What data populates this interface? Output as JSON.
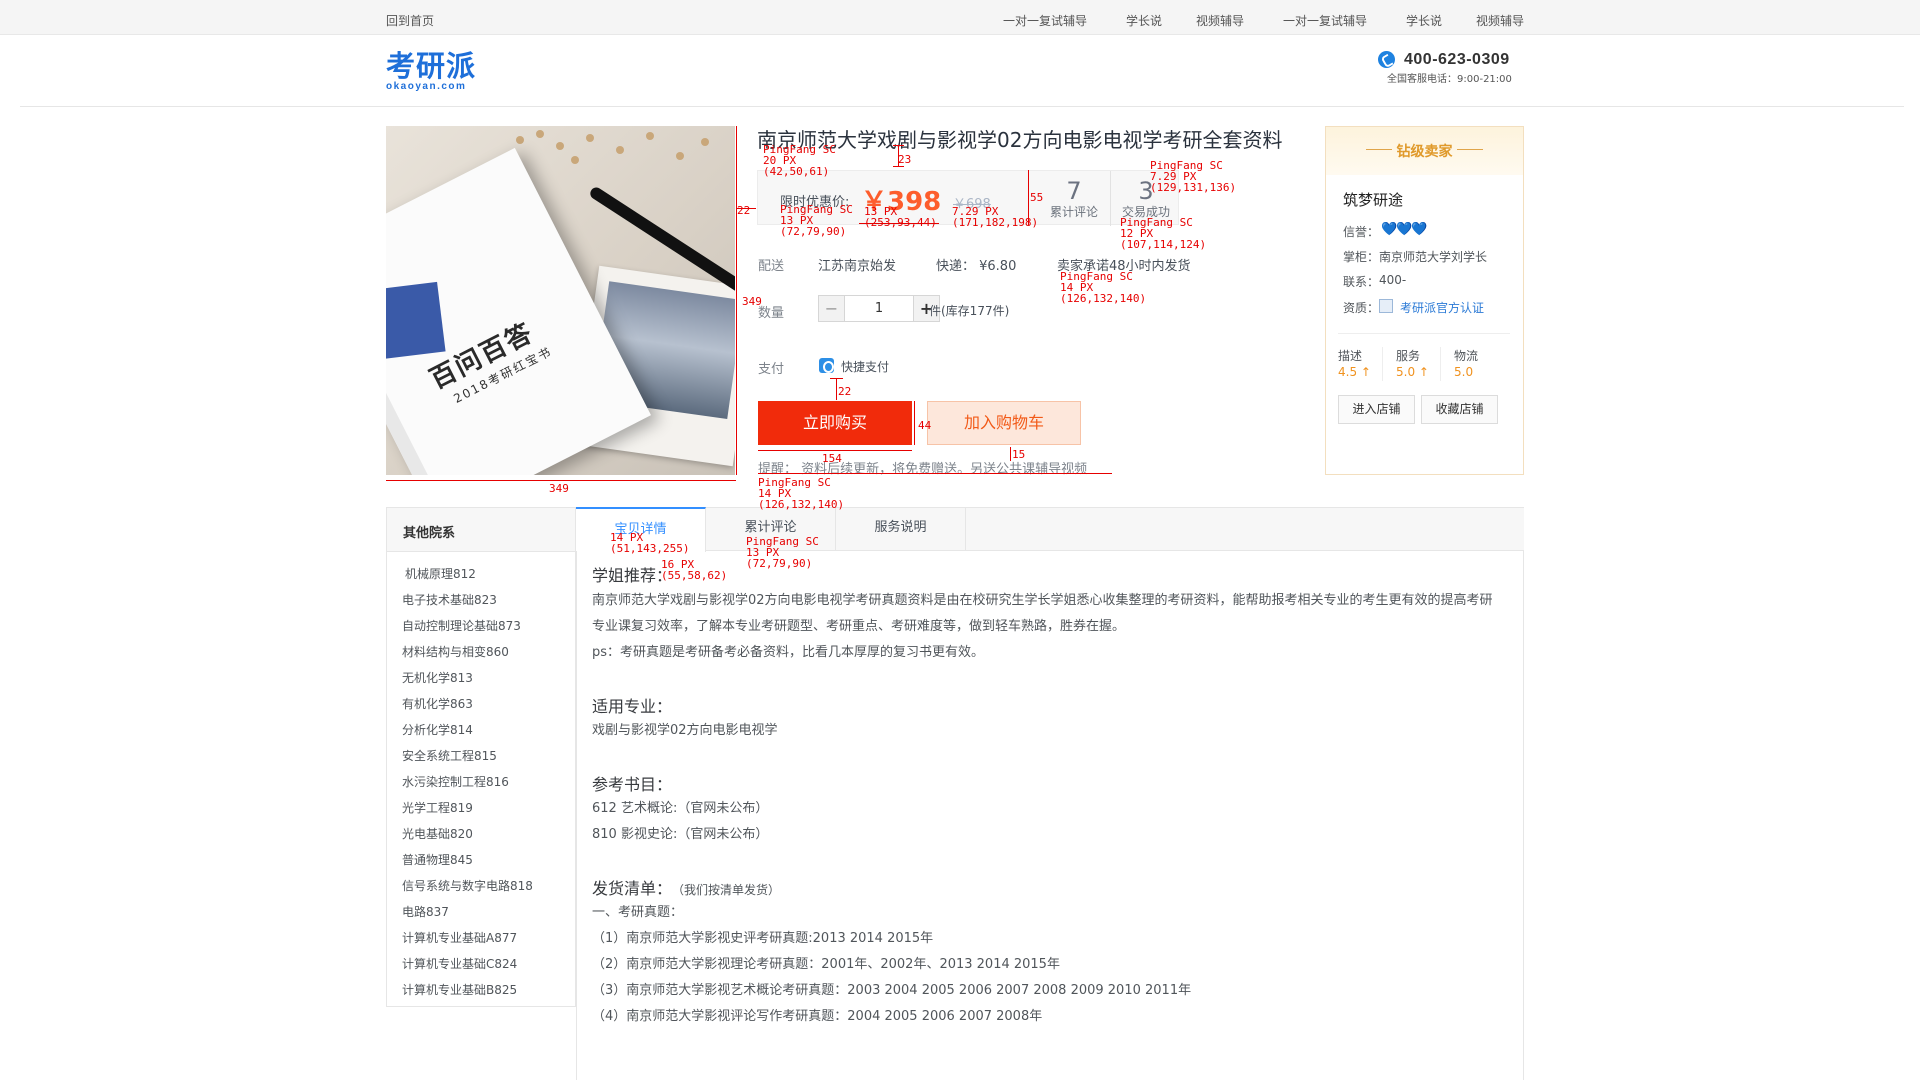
{
  "topbar": {
    "home": "回到首页",
    "nav": [
      "一对一复试辅导",
      "学长说",
      "视频辅导",
      "一对一复试辅导",
      "学长说",
      "视频辅导"
    ]
  },
  "header": {
    "logo_zh": "考研派",
    "logo_en": "okaoyan.com",
    "phone": "400-623-0309",
    "phone_sub": "全国客服电话：9:00-21:00"
  },
  "product": {
    "image_title": "百问百答",
    "image_subtitle": "2018考研红宝书",
    "title": "南京师范大学戏剧与影视学02方向电影电视学考研全套资料",
    "price_label": "限时优惠价:",
    "price": "￥398",
    "orig_price": "￥698",
    "reviews_num": "7",
    "reviews_label": "累计评论",
    "deals_num": "3",
    "deals_label": "交易成功",
    "ship_label": "配送",
    "ship_from": "江苏南京始发",
    "express": "快递： ¥6.80",
    "promise": "卖家承诺48小时内发货",
    "qty_label": "数量",
    "qty_value": "1",
    "qty_minus": "−",
    "qty_plus": "+",
    "stock": "件(库存177件)",
    "pay_label": "支付",
    "pay_method": "快捷支付",
    "buy": "立即购买",
    "cart": "加入购物车",
    "tip": "提醒： 资料后续更新，将免费赠送。另送公共课辅导视频"
  },
  "seller": {
    "badge": "钻级卖家",
    "name": "筑梦研途",
    "rep_label": "信誉：",
    "rep_value": "💙💙💙",
    "owner_label": "掌柜：",
    "owner": "南京师范大学刘学长",
    "contact_label": "联系：",
    "contact": "400-",
    "cert_label": "资质：",
    "cert": "考研派官方认证",
    "scores": [
      {
        "label": "描述",
        "value": "4.5 ↑"
      },
      {
        "label": "服务",
        "value": "5.0 ↑"
      },
      {
        "label": "物流",
        "value": "5.0"
      }
    ],
    "enter": "进入店铺",
    "fav": "收藏店铺"
  },
  "sidebar": {
    "title": "其他院系",
    "items": [
      "机械原理812",
      "电子技术基础823",
      "自动控制理论基础873",
      "材料结构与相变860",
      "无机化学813",
      "有机化学863",
      "分析化学814",
      "安全系统工程815",
      "水污染控制工程816",
      "光学工程819",
      "光电基础820",
      "普通物理845",
      "信号系统与数字电路818",
      "电路837",
      "计算机专业基础A877",
      "计算机专业基础C824",
      "计算机专业基础B825"
    ]
  },
  "tabs": [
    "宝贝详情",
    "累计评论",
    "服务说明"
  ],
  "detail": {
    "rec_title": "学姐推荐：",
    "rec_p1": "南京师范大学戏剧与影视学02方向电影电视学考研真题资料是由在校研究生学长学姐悉心收集整理的考研资料，能帮助报考相关专业的考生更有效的提高考研",
    "rec_p2": "专业课复习效率，了解本专业考研题型、考研重点、考研难度等，做到轻车熟路，胜券在握。",
    "rec_p3": "ps：考研真题是考研备考必备资料，比看几本厚厚的复习书更有效。",
    "major_title": "适用专业：",
    "major": "戏剧与影视学02方向电影电视学",
    "books_title": "参考书目：",
    "book1": "612 艺术概论:（官网未公布）",
    "book2": "810 影视史论:（官网未公布）",
    "ship_title": "发货清单：",
    "ship_note": "（我们按清单发货）",
    "list_head": "一、考研真题：",
    "list": [
      "（1）南京师范大学影视史评考研真题:2013 2014 2015年",
      "（2）南京师范大学影视理论考研真题：2001年、2002年、2013 2014 2015年",
      "（3）南京师范大学影视艺术概论考研真题：2003 2004 2005 2006 2007 2008 2009 2010 2011年",
      "（4）南京师范大学影视评论写作考研真题：2004 2005 2006 2007 2008年"
    ]
  },
  "annotations": {
    "a_title": "PingFang SC\n20 PX\n(42,50,61)",
    "a_23": "23",
    "a_22": "22",
    "a_price_lbl": "PingFang SC\n13 PX\n(72,79,90)",
    "a_price": "13 PX\n(253,93,44)",
    "a_orig": "7.29 PX\n(171,182,198)",
    "a_55": "55",
    "a_stat_num": "PingFang SC\n7.29 PX\n(129,131,136)",
    "a_stat_lbl": "PingFang SC\n12 PX\n(107,114,124)",
    "a_promise": "PingFang SC\n14 PX\n(126,132,140)",
    "a_349v": "349",
    "a_349h": "349",
    "a_pay22": "22",
    "a_44": "44",
    "a_154": "154",
    "a_15": "15",
    "a_tip": "PingFang SC\n14 PX\n(126,132,140)",
    "a_tab_active": "14 PX\n(51,143,255)",
    "a_h2": "16 PX\n(55,58,62)",
    "a_tab": "PingFang SC\n13 PX\n(72,79,90)"
  }
}
